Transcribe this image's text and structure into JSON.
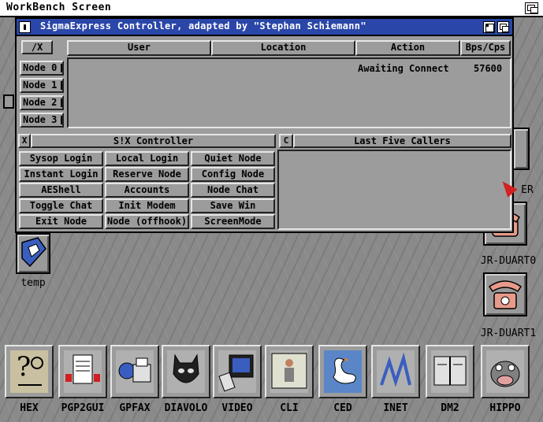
{
  "screen": {
    "title": "WorkBench Screen"
  },
  "window": {
    "title": "SigmaExpress Controller, adapted by \"Stephan Schiemann\"",
    "columns": {
      "corner": "/X",
      "user": "User",
      "location": "Location",
      "action": "Action",
      "bps": "Bps/Cps"
    },
    "nodes": [
      {
        "label": "Node 0",
        "status": "Awaiting Connect",
        "bps": "57600"
      },
      {
        "label": "Node 1"
      },
      {
        "label": "Node 2"
      },
      {
        "label": "Node 3"
      }
    ],
    "controller": {
      "toggle": "X",
      "title": "S!X Controller",
      "buttons": [
        [
          "Sysop Login",
          "Local Login",
          "Quiet Node"
        ],
        [
          "Instant Login",
          "Reserve Node",
          "Config Node"
        ],
        [
          "AEShell",
          "Accounts",
          "Node Chat"
        ],
        [
          "Toggle Chat",
          "Init Modem",
          "Save Win"
        ],
        [
          "Exit Node",
          "Node (offhook)",
          "ScreenMode"
        ]
      ]
    },
    "callers": {
      "toggle": "C",
      "title": "Last Five Callers"
    }
  },
  "desktop": {
    "left_icon": {
      "label": "temp"
    },
    "right_icons": [
      {
        "label": "JR-DUART0"
      },
      {
        "label": "JR-DUART1"
      }
    ],
    "partial_labels": {
      "er": "ER"
    }
  },
  "dock": [
    "HEX",
    "PGP2GUI",
    "GPFAX",
    "DIAVOLO",
    "VIDEO",
    "CLI",
    "CED",
    "INET",
    "DM2",
    "HIPPO"
  ],
  "colors": {
    "title_blue": "#2a46a8",
    "gray": "#9c9c9c",
    "pointer": "#d42020"
  }
}
